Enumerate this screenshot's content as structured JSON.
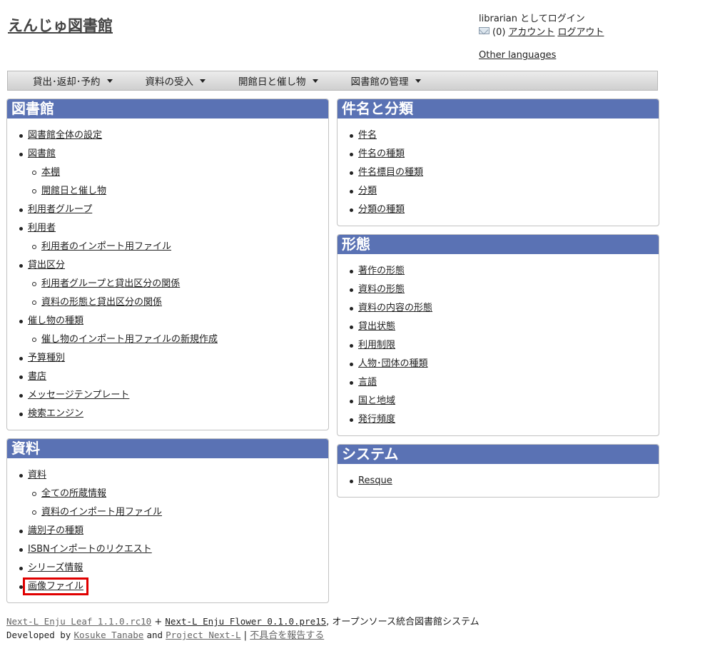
{
  "header": {
    "site_title": "えんじゅ図書館",
    "login_text": "librarian としてログイン",
    "mail_count": "(0)",
    "account_link": "アカウント",
    "logout_link": "ログアウト",
    "other_languages": "Other languages"
  },
  "nav": {
    "items": [
      {
        "label": "貸出･返却･予約"
      },
      {
        "label": "資料の受入"
      },
      {
        "label": "開館日と催し物"
      },
      {
        "label": "図書館の管理"
      }
    ]
  },
  "panels": {
    "library": {
      "title": "図書館",
      "items": [
        {
          "label": "図書館全体の設定",
          "level": 1
        },
        {
          "label": "図書館",
          "level": 1
        },
        {
          "label": "本棚",
          "level": 2
        },
        {
          "label": "開館日と催し物",
          "level": 2
        },
        {
          "label": "利用者グループ",
          "level": 1
        },
        {
          "label": "利用者",
          "level": 1
        },
        {
          "label": "利用者のインポート用ファイル",
          "level": 2
        },
        {
          "label": "貸出区分",
          "level": 1
        },
        {
          "label": "利用者グループと貸出区分の関係",
          "level": 2
        },
        {
          "label": "資料の形態と貸出区分の関係",
          "level": 2
        },
        {
          "label": "催し物の種類",
          "level": 1
        },
        {
          "label": "催し物のインポート用ファイルの新規作成",
          "level": 2
        },
        {
          "label": "予算種別",
          "level": 1
        },
        {
          "label": "書店",
          "level": 1
        },
        {
          "label": "メッセージテンプレート",
          "level": 1
        },
        {
          "label": "検索エンジン",
          "level": 1
        }
      ]
    },
    "materials": {
      "title": "資料",
      "items": [
        {
          "label": "資料",
          "level": 1
        },
        {
          "label": "全ての所蔵情報",
          "level": 2
        },
        {
          "label": "資料のインポート用ファイル",
          "level": 2
        },
        {
          "label": "識別子の種類",
          "level": 1
        },
        {
          "label": "ISBNインポートのリクエスト",
          "level": 1
        },
        {
          "label": "シリーズ情報",
          "level": 1
        },
        {
          "label": "画像ファイル",
          "level": 1,
          "highlighted": true
        }
      ]
    },
    "subjects": {
      "title": "件名と分類",
      "items": [
        {
          "label": "件名"
        },
        {
          "label": "件名の種類"
        },
        {
          "label": "件名標目の種類"
        },
        {
          "label": "分類"
        },
        {
          "label": "分類の種類"
        }
      ]
    },
    "forms": {
      "title": "形態",
      "items": [
        {
          "label": "著作の形態"
        },
        {
          "label": "資料の形態"
        },
        {
          "label": "資料の内容の形態"
        },
        {
          "label": "貸出状態"
        },
        {
          "label": "利用制限"
        },
        {
          "label": "人物･団体の種類"
        },
        {
          "label": "言語"
        },
        {
          "label": "国と地域"
        },
        {
          "label": "発行頻度"
        }
      ]
    },
    "system": {
      "title": "システム",
      "items": [
        {
          "label": "Resque"
        }
      ]
    }
  },
  "footer": {
    "leaf_link": "Next-L Enju Leaf 1.1.0.rc10",
    "plus": "+",
    "flower_link": "Next-L Enju Flower 0.1.0.pre15",
    "tagline": ", オープンソース統合図書館システム",
    "developed_by": "Developed by",
    "author_link": "Kosuke Tanabe",
    "and": "and",
    "project_link": "Project Next-L",
    "separator": "|",
    "report_link": "不具合を報告する"
  },
  "colors": {
    "panel_header": "#5a72b4",
    "highlight_border": "#e00000"
  }
}
